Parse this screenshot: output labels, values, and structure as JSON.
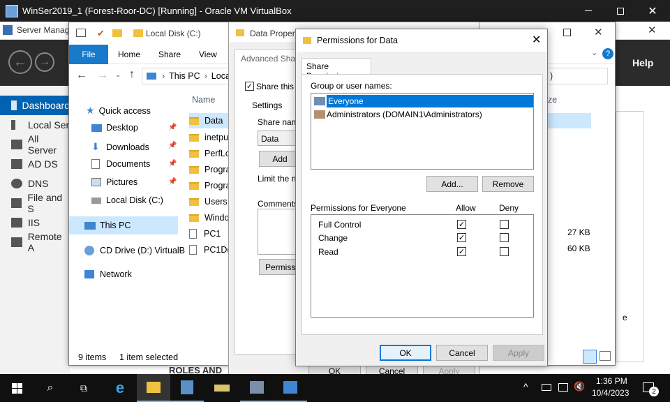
{
  "vbox": {
    "title": "WinSer2019_1 (Forest-Roor-DC) [Running] - Oracle VM VirtualBox"
  },
  "server_manager": {
    "title": "Server Manag",
    "help": "Help",
    "nav": [
      {
        "label": "Dashboard"
      },
      {
        "label": "Local Ser"
      },
      {
        "label": "All Server"
      },
      {
        "label": "AD DS"
      },
      {
        "label": "DNS"
      },
      {
        "label": "File and S"
      },
      {
        "label": "IIS"
      },
      {
        "label": "Remote A"
      }
    ],
    "roles_label": "ROLES AND"
  },
  "explorer": {
    "title_path": "Local Disk (C:)",
    "ribbon_tabs": [
      "File",
      "Home",
      "Share",
      "View"
    ],
    "breadcrumb": [
      "This PC",
      "Local"
    ],
    "column_name": "Name",
    "column_size": "ze",
    "search_tail": ")",
    "nav_quick_access": "Quick access",
    "nav_items": [
      {
        "label": "Desktop",
        "pinned": true
      },
      {
        "label": "Downloads",
        "pinned": true
      },
      {
        "label": "Documents",
        "pinned": true
      },
      {
        "label": "Pictures",
        "pinned": true
      },
      {
        "label": "Local Disk (C:)",
        "pinned": false
      }
    ],
    "nav_this_pc": "This PC",
    "nav_cd_drive": "CD Drive (D:) VirtualB",
    "nav_network": "Network",
    "files": [
      {
        "name": "Data",
        "type": "folder"
      },
      {
        "name": "inetpu",
        "type": "folder"
      },
      {
        "name": "PerfLo",
        "type": "folder"
      },
      {
        "name": "Progra",
        "type": "folder"
      },
      {
        "name": "Progra",
        "type": "folder"
      },
      {
        "name": "Users",
        "type": "folder"
      },
      {
        "name": "Windo",
        "type": "folder"
      },
      {
        "name": "PC1",
        "type": "file"
      },
      {
        "name": "PC1D(",
        "type": "file"
      }
    ],
    "sizes": {
      "pc1": "27 KB",
      "pc1d": "60 KB"
    },
    "side_e": "e",
    "status_items": "9 items",
    "status_selected": "1 item selected"
  },
  "properties": {
    "title": "Data Propert",
    "tab": "Advanced Shar",
    "share_checkbox": "Share this f",
    "settings_label": "Settings",
    "share_name_label": "Share name",
    "share_name_value": "Data",
    "add_button": "Add",
    "limit_label": "Limit the nu",
    "comments_label": "Comments:",
    "permissions_button": "Permissio",
    "ok": "OK",
    "cancel": "Cancel",
    "apply": "Apply"
  },
  "permissions": {
    "title": "Permissions for Data",
    "tab": "Share Permissions",
    "group_label": "Group or user names:",
    "users": [
      {
        "name": "Everyone",
        "selected": true
      },
      {
        "name": "Administrators (DOMAIN1\\Administrators)",
        "selected": false
      }
    ],
    "add_button": "Add...",
    "remove_button": "Remove",
    "perm_header": "Permissions for Everyone",
    "allow_header": "Allow",
    "deny_header": "Deny",
    "rows": [
      {
        "name": "Full Control",
        "allow": true,
        "deny": false
      },
      {
        "name": "Change",
        "allow": true,
        "deny": false
      },
      {
        "name": "Read",
        "allow": true,
        "deny": false
      }
    ],
    "ok": "OK",
    "cancel": "Cancel",
    "apply": "Apply"
  },
  "taskbar": {
    "time": "1:36 PM",
    "date": "10/4/2023",
    "notification_count": "2"
  },
  "colors": {
    "accent": "#0078d7",
    "selection": "#0078d7",
    "taskbar": "#101010"
  }
}
